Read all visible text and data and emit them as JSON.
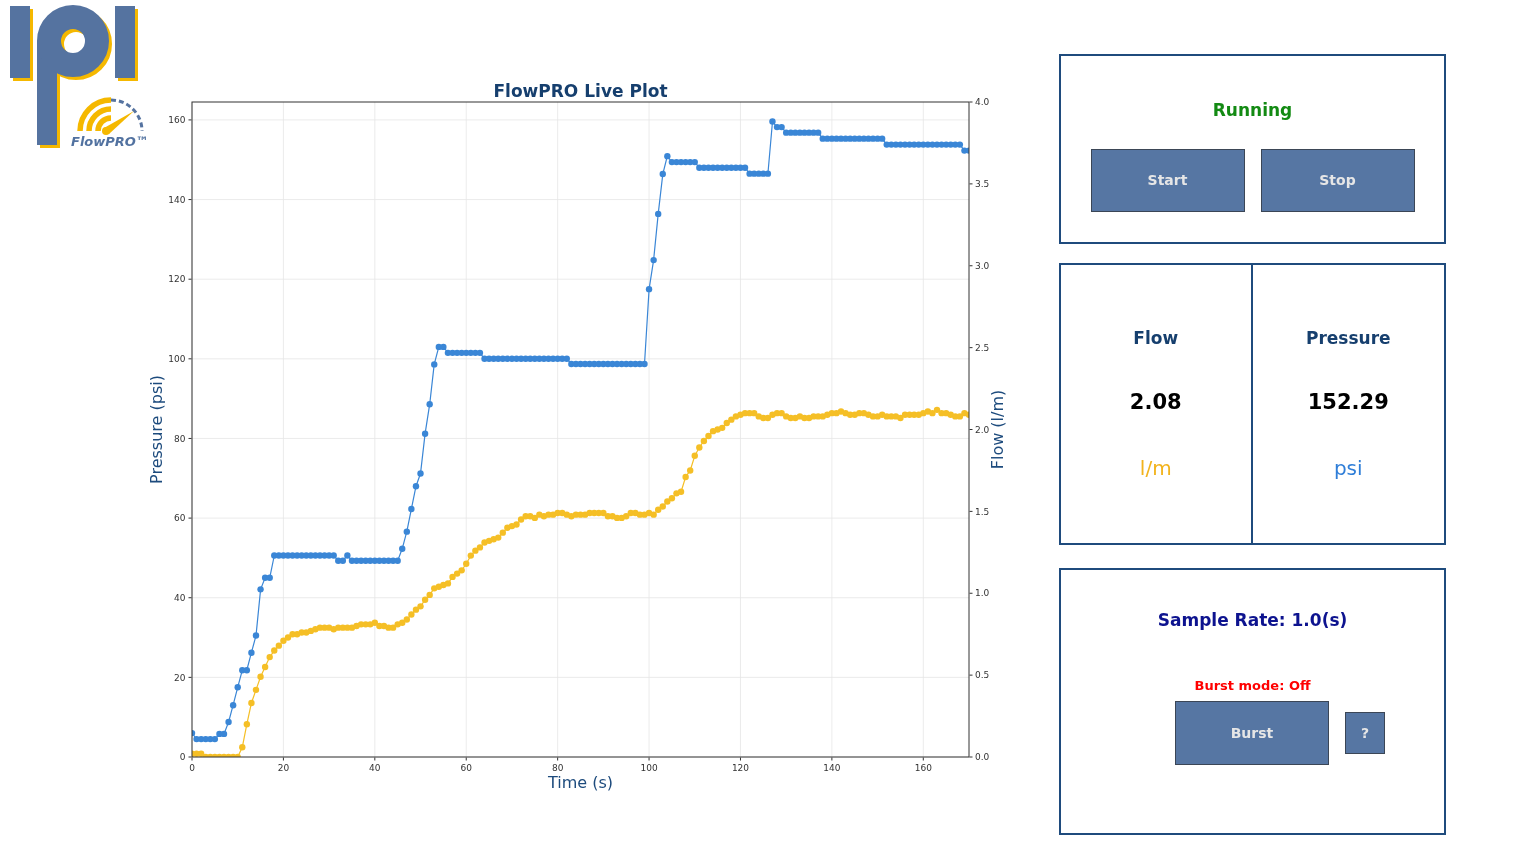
{
  "logo": {
    "wordmark": "FlowPRO™"
  },
  "plot": {
    "chart_data": {
      "type": "line",
      "title": "FlowPRO Live Plot",
      "xlabel": "Time (s)",
      "ylabel": "Pressure (psi)",
      "y2label": "Flow (l/m)",
      "grid": true,
      "x": [
        0,
        1,
        2,
        3,
        4,
        5,
        6,
        7,
        8,
        9,
        10,
        11,
        12,
        13,
        14,
        15,
        16,
        17,
        18,
        19,
        20,
        21,
        22,
        23,
        24,
        25,
        26,
        27,
        28,
        29,
        30,
        31,
        32,
        33,
        34,
        35,
        36,
        37,
        38,
        39,
        40,
        41,
        42,
        43,
        44,
        45,
        46,
        47,
        48,
        49,
        50,
        51,
        52,
        53,
        54,
        55,
        56,
        57,
        58,
        59,
        60,
        61,
        62,
        63,
        64,
        65,
        66,
        67,
        68,
        69,
        70,
        71,
        72,
        73,
        74,
        75,
        76,
        77,
        78,
        79,
        80,
        81,
        82,
        83,
        84,
        85,
        86,
        87,
        88,
        89,
        90,
        91,
        92,
        93,
        94,
        95,
        96,
        97,
        98,
        99,
        100,
        101,
        102,
        103,
        104,
        105,
        106,
        107,
        108,
        109,
        110,
        111,
        112,
        113,
        114,
        115,
        116,
        117,
        118,
        119,
        120,
        121,
        122,
        123,
        124,
        125,
        126,
        127,
        128,
        129,
        130,
        131,
        132,
        133,
        134,
        135,
        136,
        137,
        138,
        139,
        140,
        141,
        142,
        143,
        144,
        145,
        146,
        147,
        148,
        149,
        150,
        151,
        152,
        153,
        154,
        155,
        156,
        157,
        158,
        159,
        160,
        161,
        162,
        163,
        164,
        165,
        166,
        167,
        168,
        169,
        170
      ],
      "xlim": [
        0,
        170
      ],
      "ylim": [
        0,
        164.5
      ],
      "y2lim": [
        0,
        4
      ],
      "xticks": [
        0,
        20,
        40,
        60,
        80,
        100,
        120,
        140,
        160
      ],
      "yticks": [
        0,
        20,
        40,
        60,
        80,
        100,
        120,
        140,
        160
      ],
      "y2ticks": [
        {
          "value": 0,
          "label": "0.0"
        },
        {
          "value": 0.5,
          "label": "0.5"
        },
        {
          "value": 1,
          "label": "1.0"
        },
        {
          "value": 1.5,
          "label": "1.5"
        },
        {
          "value": 2,
          "label": "2.0"
        },
        {
          "value": 2.5,
          "label": "2.5"
        },
        {
          "value": 3,
          "label": "3.0"
        },
        {
          "value": 3.5,
          "label": "3.5"
        },
        {
          "value": 4,
          "label": "4.0"
        }
      ],
      "series": [
        {
          "color": "#3a86d6",
          "marker": "circle",
          "values": [
            6,
            4.5,
            4.5,
            4.5,
            4.5,
            4.5,
            5.8,
            5.8,
            8.8,
            13,
            17.5,
            21.8,
            21.8,
            26.2,
            30.5,
            42.1,
            45,
            45,
            50.6,
            50.6,
            50.6,
            50.6,
            50.6,
            50.6,
            50.6,
            50.6,
            50.6,
            50.6,
            50.6,
            50.6,
            50.6,
            50.6,
            49.3,
            49.3,
            50.6,
            49.3,
            49.3,
            49.3,
            49.3,
            49.3,
            49.3,
            49.3,
            49.3,
            49.3,
            49.3,
            49.3,
            52.3,
            56.6,
            62.3,
            68,
            71.2,
            81.2,
            88.6,
            98.6,
            103,
            103,
            101.5,
            101.5,
            101.5,
            101.5,
            101.5,
            101.5,
            101.5,
            101.5,
            100,
            100,
            100,
            100,
            100,
            100,
            100,
            100,
            100,
            100,
            100,
            100,
            100,
            100,
            100,
            100,
            100,
            100,
            100,
            98.7,
            98.7,
            98.7,
            98.7,
            98.7,
            98.7,
            98.7,
            98.7,
            98.7,
            98.7,
            98.7,
            98.7,
            98.7,
            98.7,
            98.7,
            98.7,
            98.7,
            117.5,
            124.8,
            136.4,
            146.4,
            150.9,
            149.4,
            149.4,
            149.4,
            149.4,
            149.4,
            149.4,
            148,
            148,
            148,
            148,
            148,
            148,
            148,
            148,
            148,
            148,
            148,
            146.5,
            146.5,
            146.5,
            146.5,
            146.5,
            159.6,
            158.2,
            158.2,
            156.8,
            156.8,
            156.8,
            156.8,
            156.8,
            156.8,
            156.8,
            156.8,
            155.3,
            155.3,
            155.3,
            155.3,
            155.3,
            155.3,
            155.3,
            155.3,
            155.3,
            155.3,
            155.3,
            155.3,
            155.3,
            155.3,
            153.8,
            153.8,
            153.8,
            153.8,
            153.8,
            153.8,
            153.8,
            153.8,
            153.8,
            153.8,
            153.8,
            153.8,
            153.8,
            153.8,
            153.8,
            153.8,
            153.8,
            152.3,
            152.3
          ]
        },
        {
          "color": "#f5bf26",
          "axis": "y2",
          "marker": "circle",
          "values": [
            0.02,
            0.02,
            0.02,
            0,
            0,
            0,
            0,
            0,
            0,
            0,
            0,
            0.06,
            0.2,
            0.33,
            0.41,
            0.49,
            0.55,
            0.61,
            0.65,
            0.68,
            0.71,
            0.73,
            0.75,
            0.75,
            0.76,
            0.76,
            0.77,
            0.78,
            0.79,
            0.79,
            0.79,
            0.78,
            0.79,
            0.79,
            0.79,
            0.79,
            0.8,
            0.81,
            0.81,
            0.81,
            0.82,
            0.8,
            0.8,
            0.79,
            0.79,
            0.81,
            0.82,
            0.84,
            0.87,
            0.9,
            0.92,
            0.96,
            0.99,
            1.03,
            1.04,
            1.05,
            1.06,
            1.1,
            1.12,
            1.14,
            1.18,
            1.23,
            1.26,
            1.28,
            1.31,
            1.32,
            1.33,
            1.34,
            1.37,
            1.4,
            1.41,
            1.42,
            1.45,
            1.47,
            1.47,
            1.46,
            1.48,
            1.47,
            1.48,
            1.48,
            1.49,
            1.49,
            1.48,
            1.47,
            1.48,
            1.48,
            1.48,
            1.49,
            1.49,
            1.49,
            1.49,
            1.47,
            1.47,
            1.46,
            1.46,
            1.47,
            1.49,
            1.49,
            1.48,
            1.48,
            1.49,
            1.48,
            1.51,
            1.53,
            1.56,
            1.58,
            1.61,
            1.62,
            1.71,
            1.75,
            1.84,
            1.89,
            1.93,
            1.96,
            1.99,
            2,
            2.01,
            2.04,
            2.06,
            2.08,
            2.09,
            2.1,
            2.1,
            2.1,
            2.08,
            2.07,
            2.07,
            2.09,
            2.1,
            2.1,
            2.08,
            2.07,
            2.07,
            2.08,
            2.07,
            2.07,
            2.08,
            2.08,
            2.08,
            2.09,
            2.1,
            2.1,
            2.11,
            2.1,
            2.09,
            2.09,
            2.1,
            2.1,
            2.09,
            2.08,
            2.08,
            2.09,
            2.08,
            2.08,
            2.08,
            2.07,
            2.09,
            2.09,
            2.09,
            2.09,
            2.1,
            2.11,
            2.1,
            2.12,
            2.1,
            2.1,
            2.09,
            2.08,
            2.08,
            2.1,
            2.09
          ]
        }
      ]
    }
  },
  "control_panel": {
    "status": {
      "text": "Running",
      "running": true
    },
    "buttons": [
      {
        "label": "Start"
      },
      {
        "label": "Stop"
      }
    ]
  },
  "readings": [
    {
      "label": "Flow",
      "value": "2.08",
      "unit": "l/m",
      "color": "#f2b31c"
    },
    {
      "label": "Pressure",
      "value": "152.29",
      "unit": "psi",
      "color": "#2f7ed8"
    }
  ],
  "sample_panel": {
    "sample_rate": "Sample Rate: 1.0(s)",
    "burst_status": {
      "text": "Burst mode: Off",
      "on": false
    },
    "buttons": [
      {
        "label": "Burst",
        "kind": "burst"
      },
      {
        "label": "?",
        "kind": "help"
      }
    ]
  }
}
